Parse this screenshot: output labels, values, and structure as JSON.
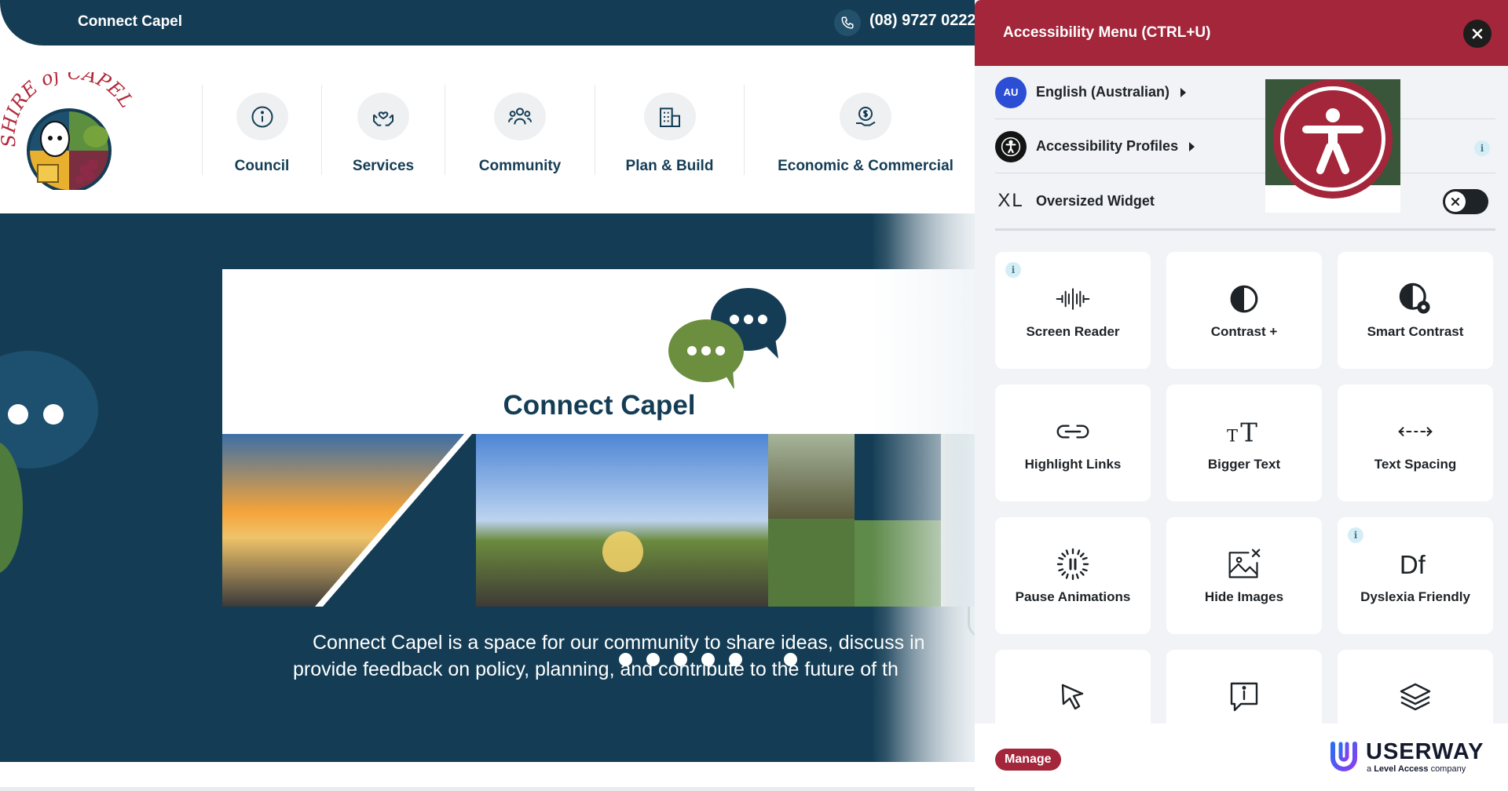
{
  "topbar": {
    "brand": "Connect Capel",
    "phone": "(08) 9727 0222"
  },
  "logo": {
    "alt": "Shire of Capel",
    "text_top": "SHIRE of CAPEL"
  },
  "nav": {
    "items": [
      {
        "label": "Council",
        "icon": "info-icon"
      },
      {
        "label": "Services",
        "icon": "hands-heart-icon"
      },
      {
        "label": "Community",
        "icon": "people-icon"
      },
      {
        "label": "Plan & Build",
        "icon": "building-icon"
      },
      {
        "label": "Economic & Commercial",
        "icon": "money-hand-icon"
      }
    ]
  },
  "hero": {
    "card_title": "Connect Capel",
    "text_line1": "Connect Capel is a space for our community to share ideas, discuss in",
    "text_line2": "provide feedback on policy, planning, and contribute to the future of th",
    "slide_count": 6,
    "active_slide": 0
  },
  "panel": {
    "title": "Accessibility Menu (CTRL+U)",
    "language": {
      "badge": "AU",
      "label": "English (Australian)"
    },
    "profiles": {
      "label": "Accessibility Profiles"
    },
    "oversized": {
      "prefix": "XL",
      "label": "Oversized Widget",
      "enabled": false
    },
    "tiles": [
      {
        "label": "Screen Reader",
        "icon": "sound-wave-icon",
        "info": true
      },
      {
        "label": "Contrast +",
        "icon": "contrast-icon",
        "info": false
      },
      {
        "label": "Smart Contrast",
        "icon": "smart-contrast-icon",
        "info": false
      },
      {
        "label": "Highlight Links",
        "icon": "link-icon",
        "info": false
      },
      {
        "label": "Bigger Text",
        "icon": "text-size-icon",
        "info": false
      },
      {
        "label": "Text Spacing",
        "icon": "spacing-arrows-icon",
        "info": false
      },
      {
        "label": "Pause Animations",
        "icon": "pause-circle-icon",
        "info": false
      },
      {
        "label": "Hide Images",
        "icon": "hide-image-icon",
        "info": false
      },
      {
        "label": "Dyslexia Friendly",
        "icon": "dyslexia-font-icon",
        "info": true
      },
      {
        "label": "",
        "icon": "cursor-icon",
        "info": false
      },
      {
        "label": "",
        "icon": "tooltip-icon",
        "info": false
      },
      {
        "label": "",
        "icon": "layers-icon",
        "info": false
      }
    ],
    "manage_label": "Manage",
    "vendor": {
      "name": "USERWAY",
      "sub_prefix": "a",
      "sub_brand": "Level Access",
      "sub_suffix": "company"
    }
  },
  "colors": {
    "navy": "#143d55",
    "panel_red": "#a3263a",
    "green": "#4f7b3d",
    "blue_badge": "#2b4ed4"
  }
}
